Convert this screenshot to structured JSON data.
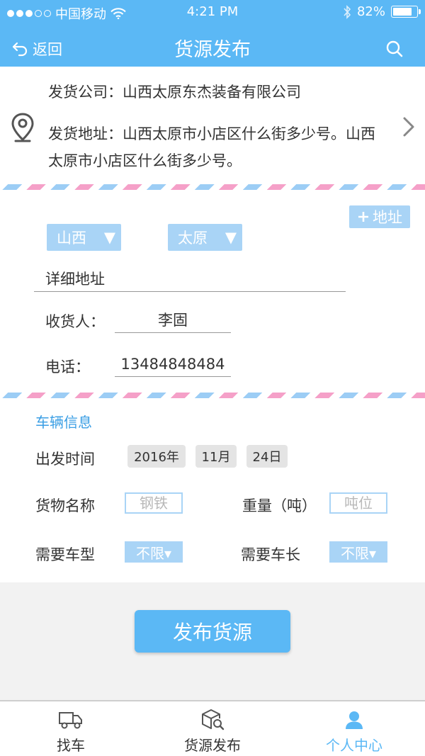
{
  "status_bar": {
    "carrier": "中国移动",
    "time": "4:21 PM",
    "battery_text": "82%",
    "battery_level": 0.82
  },
  "nav": {
    "back_label": "返回",
    "title": "货源发布"
  },
  "sender": {
    "company_label": "发货公司：",
    "company": "山西太原东杰装备有限公司",
    "address_label": "发货地址：",
    "address": "山西太原市小店区什么街多少号。山西太原市小店区什么街多少号。"
  },
  "receiver": {
    "add_address_label": "地址",
    "province": "山西",
    "city": "太原",
    "detail_address": "详细地址",
    "consignee_label": "收货人：",
    "consignee": "李固",
    "phone_label": "电话：",
    "phone": "13484848484"
  },
  "vehicle": {
    "section_title": "车辆信息",
    "departure_label": "出发时间",
    "year": "2016年",
    "month": "11月",
    "day": "24日",
    "goods_label": "货物名称",
    "goods_placeholder": "钢铁",
    "weight_label": "重量（吨）",
    "weight_placeholder": "吨位",
    "vehicle_type_label": "需要车型",
    "vehicle_type": "不限▾",
    "vehicle_length_label": "需要车长",
    "vehicle_length": "不限▾"
  },
  "submit_label": "发布货源",
  "tabs": [
    {
      "label": "找车",
      "icon": "truck-icon",
      "active": false
    },
    {
      "label": "货源发布",
      "icon": "package-search-icon",
      "active": false
    },
    {
      "label": "个人中心",
      "icon": "user-icon",
      "active": true
    }
  ],
  "colors": {
    "primary": "#5bb8f5",
    "select_bg": "#a9d4f6",
    "section_title": "#3a9ee4",
    "stripe_pink": "#f5a0c8",
    "stripe_blue": "#9ccdf5"
  }
}
